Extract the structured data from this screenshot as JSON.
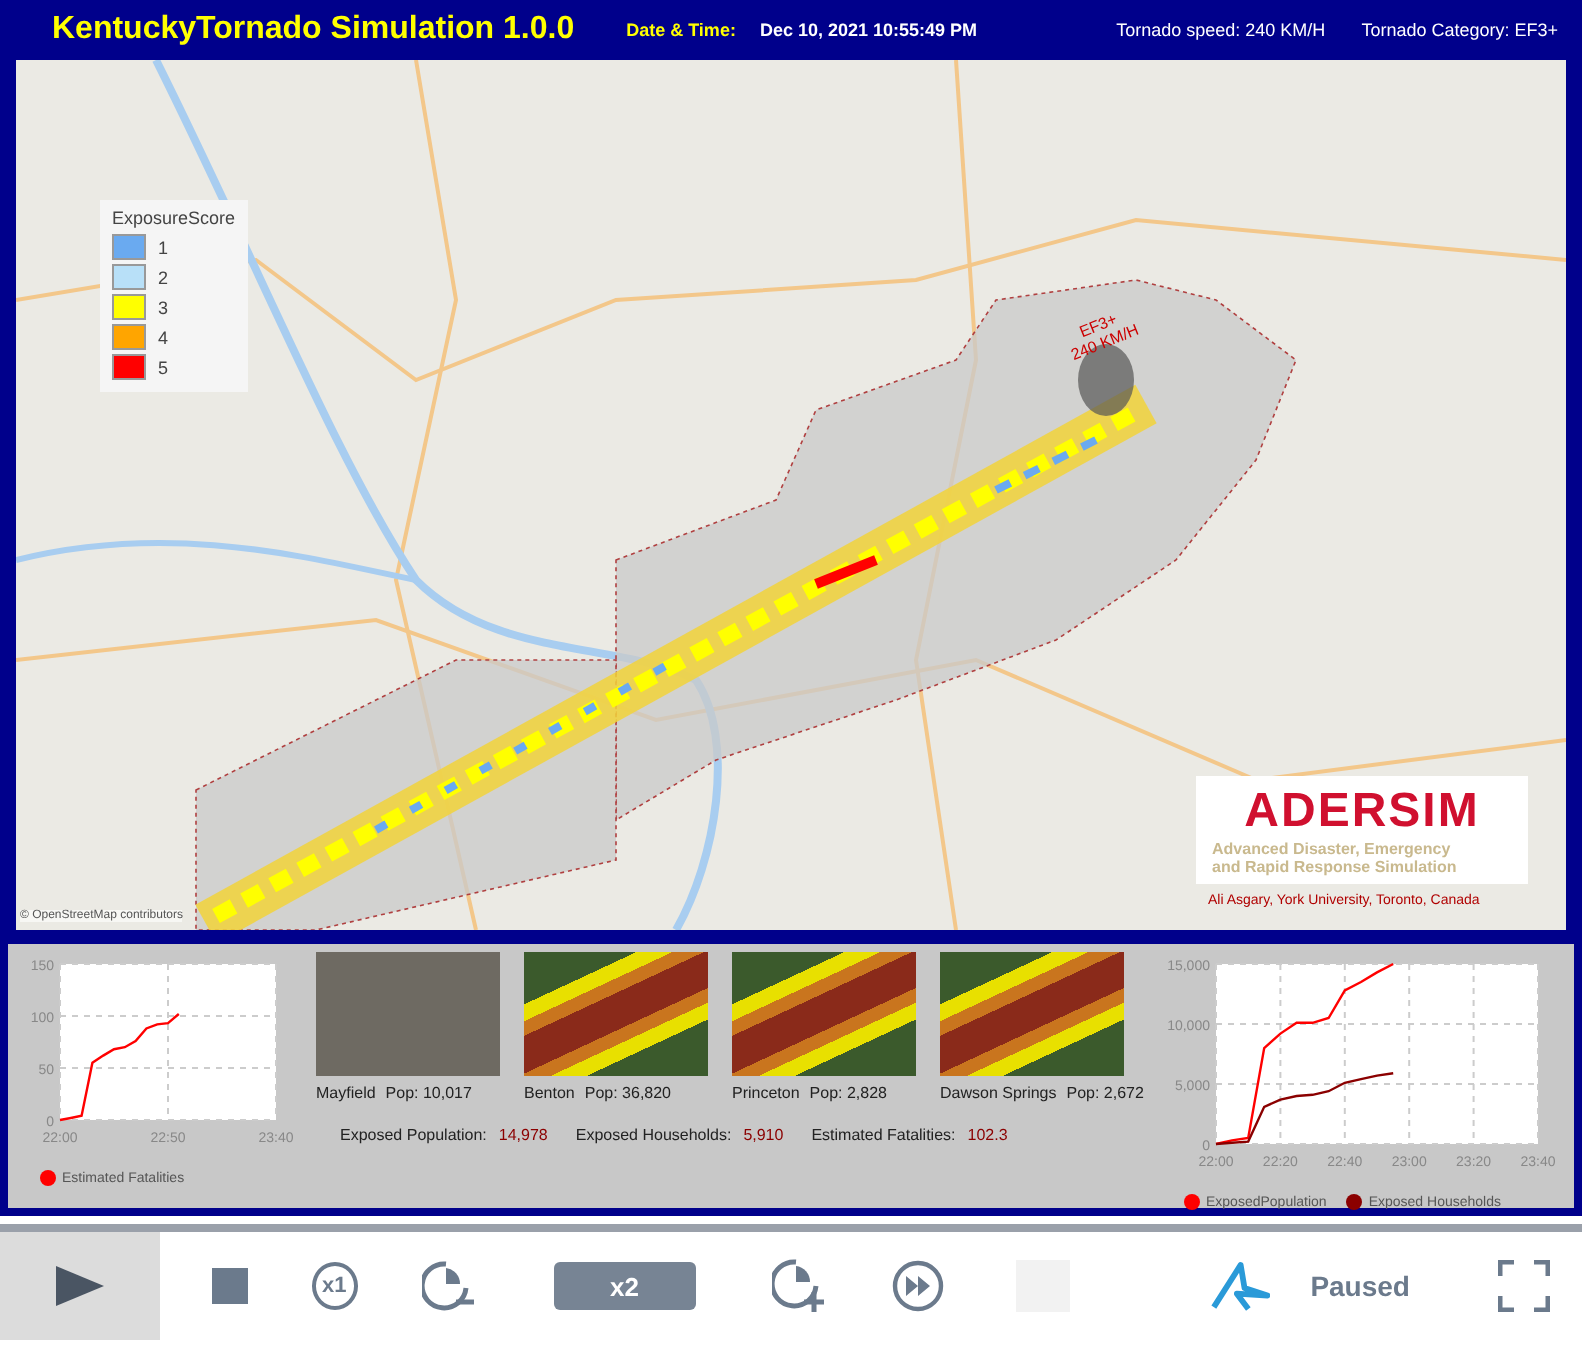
{
  "header": {
    "title": "KentuckyTornado Simulation 1.0.0",
    "date_label": "Date & Time:",
    "date_value": "Dec 10, 2021 10:55:49 PM",
    "speed": "Tornado speed: 240 KM/H",
    "category": "Tornado Category: EF3+"
  },
  "map": {
    "legend": {
      "title": "ExposureScore",
      "items": [
        {
          "label": "1",
          "color": "#6aaaf0"
        },
        {
          "label": "2",
          "color": "#b8e0f8"
        },
        {
          "label": "3",
          "color": "#ffff00"
        },
        {
          "label": "4",
          "color": "#ffa500"
        },
        {
          "label": "5",
          "color": "#ff0000"
        }
      ]
    },
    "storm_label": [
      "EF3+",
      "240 KM/H"
    ],
    "logo": {
      "name": "ADERSIM",
      "subtitle": [
        "Advanced Disaster, Emergency",
        "and Rapid Response Simulation"
      ]
    },
    "credit": "Ali Asgary, York University, Toronto, Canada",
    "attribution": "© OpenStreetMap contributors"
  },
  "panel": {
    "fatalities_chart": {
      "chart_data": {
        "type": "line",
        "grid": true,
        "categories": [
          "22:00",
          null,
          null,
          null,
          null,
          null,
          null,
          null,
          null,
          null,
          "22:50",
          null,
          null,
          null,
          null,
          null,
          null,
          null,
          null,
          null,
          "23:40"
        ],
        "ylim": [
          0,
          150
        ],
        "yticks": [
          0,
          50,
          100,
          150
        ],
        "series": [
          {
            "name": "Estimated Fatalities",
            "color": "#ff0000",
            "values": [
              0,
              2,
              4,
              55,
              62,
              68,
              70,
              76,
              88,
              92,
              93,
              102,
              null,
              null,
              null,
              null,
              null,
              null,
              null,
              null,
              null
            ]
          }
        ]
      }
    },
    "towns": [
      {
        "name": "Mayfield",
        "pop": "Pop: 10,017",
        "kind": "city"
      },
      {
        "name": "Benton",
        "pop": "Pop: 36,820",
        "kind": "swath"
      },
      {
        "name": "Princeton",
        "pop": "Pop: 2,828",
        "kind": "swath"
      },
      {
        "name": "Dawson Springs",
        "pop": "Pop: 2,672",
        "kind": "swath"
      }
    ],
    "stats": [
      {
        "label": "Exposed Population:",
        "value": "14,978"
      },
      {
        "label": "Exposed Households:",
        "value": "5,910"
      },
      {
        "label": "Estimated Fatalities:",
        "value": "102.3"
      }
    ],
    "exposure_chart": {
      "chart_data": {
        "type": "line",
        "grid": true,
        "categories": [
          "22:00",
          null,
          null,
          null,
          "22:20",
          null,
          null,
          null,
          "22:40",
          null,
          null,
          null,
          "23:00",
          null,
          null,
          null,
          "23:20",
          null,
          null,
          null,
          "23:40"
        ],
        "ylim": [
          0,
          15000
        ],
        "yticks": [
          {
            "value": 0,
            "label": "0"
          },
          {
            "value": 5000,
            "label": "5,000"
          },
          {
            "value": 10000,
            "label": "10,000"
          },
          {
            "value": 15000,
            "label": "15,000"
          }
        ],
        "series": [
          {
            "name": "ExposedPopulation",
            "color": "#ff0000",
            "values": [
              0,
              300,
              500,
              8000,
              9200,
              10100,
              10100,
              10500,
              12800,
              13500,
              14300,
              15000,
              null,
              null,
              null,
              null,
              null,
              null,
              null,
              null,
              null
            ]
          },
          {
            "name": "Exposed Households",
            "color": "#8b0000",
            "values": [
              0,
              100,
              200,
              3100,
              3700,
              4000,
              4100,
              4400,
              5100,
              5400,
              5700,
              5900,
              null,
              null,
              null,
              null,
              null,
              null,
              null,
              null,
              null
            ]
          }
        ]
      }
    }
  },
  "toolbar": {
    "items": [
      {
        "kind": "play"
      },
      {
        "kind": "stop"
      },
      {
        "kind": "normal-speed",
        "label": "x1"
      },
      {
        "kind": "slower"
      },
      {
        "kind": "speed",
        "label": "x2"
      },
      {
        "kind": "faster"
      },
      {
        "kind": "skip"
      },
      {
        "kind": "blank"
      },
      {
        "kind": "logo"
      },
      {
        "kind": "status",
        "label": "Paused"
      },
      {
        "kind": "fullscreen"
      }
    ]
  }
}
